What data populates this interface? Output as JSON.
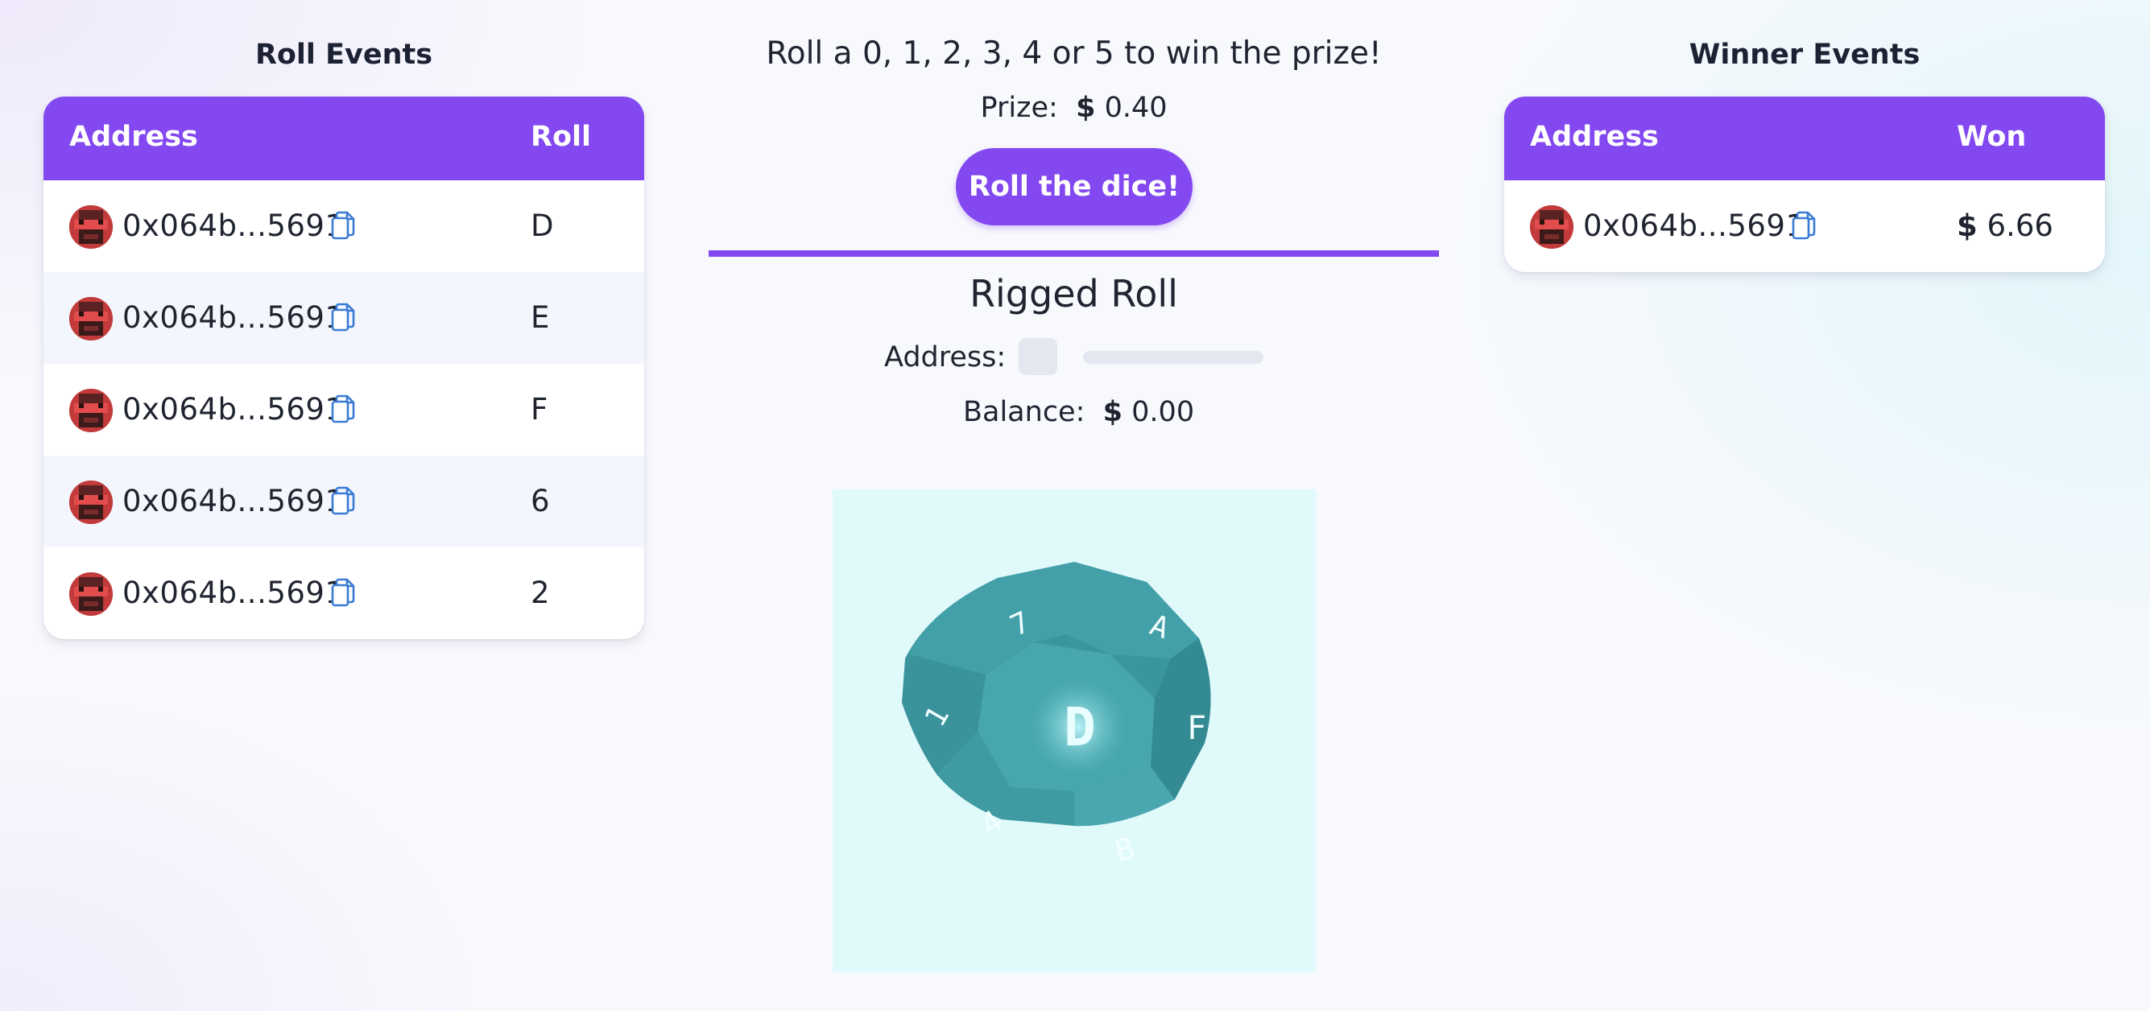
{
  "roll_events": {
    "title": "Roll Events",
    "headers": {
      "address": "Address",
      "roll": "Roll"
    },
    "rows": [
      {
        "address": "0x064b...5691",
        "roll": "D"
      },
      {
        "address": "0x064b...5691",
        "roll": "E"
      },
      {
        "address": "0x064b...5691",
        "roll": "F"
      },
      {
        "address": "0x064b...5691",
        "roll": "6"
      },
      {
        "address": "0x064b...5691",
        "roll": "2"
      }
    ]
  },
  "game": {
    "instruction": "Roll a 0, 1, 2, 3, 4 or 5 to win the prize!",
    "prize_label": "Prize:",
    "prize_currency": "$",
    "prize_value": "0.40",
    "roll_button": "Roll the dice!"
  },
  "rigged": {
    "title": "Rigged Roll",
    "address_label": "Address:",
    "balance_label": "Balance:",
    "balance_currency": "$",
    "balance_value": "0.00"
  },
  "dice": {
    "faces": [
      "D",
      "7",
      "A",
      "F",
      "1",
      "4",
      "B"
    ],
    "background_color": "#e0f9fb",
    "die_color": "#3e9ba3"
  },
  "winner_events": {
    "title": "Winner Events",
    "headers": {
      "address": "Address",
      "won": "Won"
    },
    "rows": [
      {
        "address": "0x064b...5691",
        "currency": "$",
        "won": "6.66"
      }
    ]
  },
  "colors": {
    "accent": "#8348f0",
    "copy_icon": "#3a7bd5",
    "stripe": "#f3f6fd"
  },
  "icons": [
    "avatar-icon",
    "copy-icon"
  ]
}
